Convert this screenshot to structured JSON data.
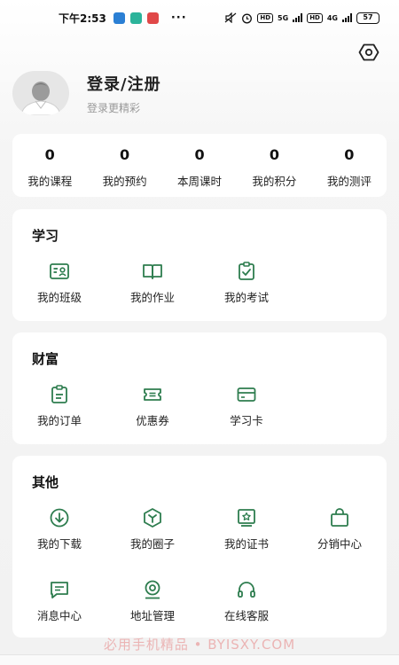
{
  "status_bar": {
    "time": "下午2:53",
    "more": "···",
    "hd1": "HD",
    "net1": "5G",
    "hd2": "HD",
    "net2": "4G",
    "battery": "57"
  },
  "header": {
    "settings_icon": "settings-hex-icon"
  },
  "profile": {
    "title": "登录/注册",
    "subtitle": "登录更精彩",
    "avatar_icon": "default-avatar-icon"
  },
  "stats": [
    {
      "value": "0",
      "label": "我的课程"
    },
    {
      "value": "0",
      "label": "我的预约"
    },
    {
      "value": "0",
      "label": "本周课时"
    },
    {
      "value": "0",
      "label": "我的积分"
    },
    {
      "value": "0",
      "label": "我的测评"
    }
  ],
  "sections": {
    "study": {
      "title": "学习",
      "items": [
        {
          "label": "我的班级",
          "icon": "class-card-icon"
        },
        {
          "label": "我的作业",
          "icon": "book-icon"
        },
        {
          "label": "我的考试",
          "icon": "clipboard-check-icon"
        }
      ]
    },
    "wealth": {
      "title": "财富",
      "items": [
        {
          "label": "我的订单",
          "icon": "order-clipboard-icon"
        },
        {
          "label": "优惠券",
          "icon": "coupon-icon"
        },
        {
          "label": "学习卡",
          "icon": "card-icon"
        }
      ]
    },
    "other": {
      "title": "其他",
      "items": [
        {
          "label": "我的下载",
          "icon": "download-icon"
        },
        {
          "label": "我的圈子",
          "icon": "circle-hex-icon"
        },
        {
          "label": "我的证书",
          "icon": "certificate-icon"
        },
        {
          "label": "分销中心",
          "icon": "shopping-bag-icon"
        },
        {
          "label": "消息中心",
          "icon": "message-icon"
        },
        {
          "label": "地址管理",
          "icon": "location-icon"
        },
        {
          "label": "在线客服",
          "icon": "headset-icon"
        }
      ]
    }
  },
  "watermark": "必用手机精品 • BYISXY.COM",
  "colors": {
    "accent": "#2e7d4f",
    "card": "#ffffff",
    "background": "#f2f2f2"
  }
}
